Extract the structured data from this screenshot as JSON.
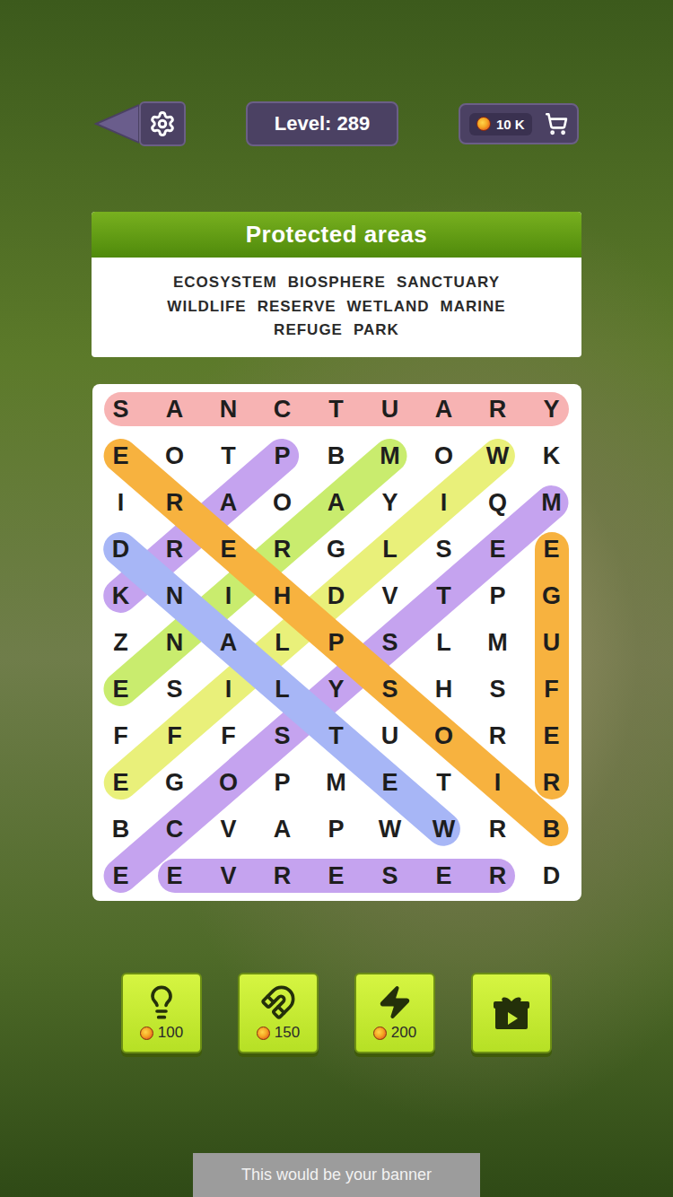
{
  "header": {
    "level": "Level: 289",
    "coins": "10 K"
  },
  "category": {
    "title": "Protected areas",
    "words": [
      "ECOSYSTEM",
      "BIOSPHERE",
      "SANCTUARY",
      "WILDLIFE",
      "RESERVE",
      "WETLAND",
      "MARINE",
      "REFUGE",
      "PARK"
    ]
  },
  "grid": {
    "rows": [
      "SANCTUARY",
      "EOTPBMOWK",
      "IRAOAYIQM",
      "DRERGLSEE",
      "KNIHDVTPG",
      "ZNALPSLMU",
      "ESILYSHSF",
      "FFFSTUORE",
      "EGOPMETIR",
      "BCVAPWWRB",
      "EEVRESERD"
    ],
    "highlights": [
      {
        "from": [
          0,
          0
        ],
        "to": [
          0,
          8
        ],
        "color": "#f7b3b3"
      },
      {
        "from": [
          10,
          0
        ],
        "to": [
          2,
          8
        ],
        "color": "#c5a3ef"
      },
      {
        "from": [
          10,
          1
        ],
        "to": [
          10,
          7
        ],
        "color": "#c5a3ef"
      },
      {
        "from": [
          1,
          3
        ],
        "to": [
          4,
          0
        ],
        "color": "#c5a3ef"
      },
      {
        "from": [
          1,
          7
        ],
        "to": [
          8,
          0
        ],
        "color": "#e9f07a"
      },
      {
        "from": [
          1,
          5
        ],
        "to": [
          6,
          0
        ],
        "color": "#c9ec6e"
      },
      {
        "from": [
          3,
          0
        ],
        "to": [
          9,
          6
        ],
        "color": "#a7b6f6"
      },
      {
        "from": [
          3,
          8
        ],
        "to": [
          8,
          8
        ],
        "color": "#f7b23f"
      },
      {
        "from": [
          1,
          0
        ],
        "to": [
          9,
          8
        ],
        "color": "#f7b23f"
      }
    ]
  },
  "boosters": [
    {
      "kind": "hint",
      "price": "100"
    },
    {
      "kind": "magnet",
      "price": "150"
    },
    {
      "kind": "lightning",
      "price": "200"
    },
    {
      "kind": "gift"
    }
  ],
  "banner": {
    "text": "This would be your banner"
  }
}
